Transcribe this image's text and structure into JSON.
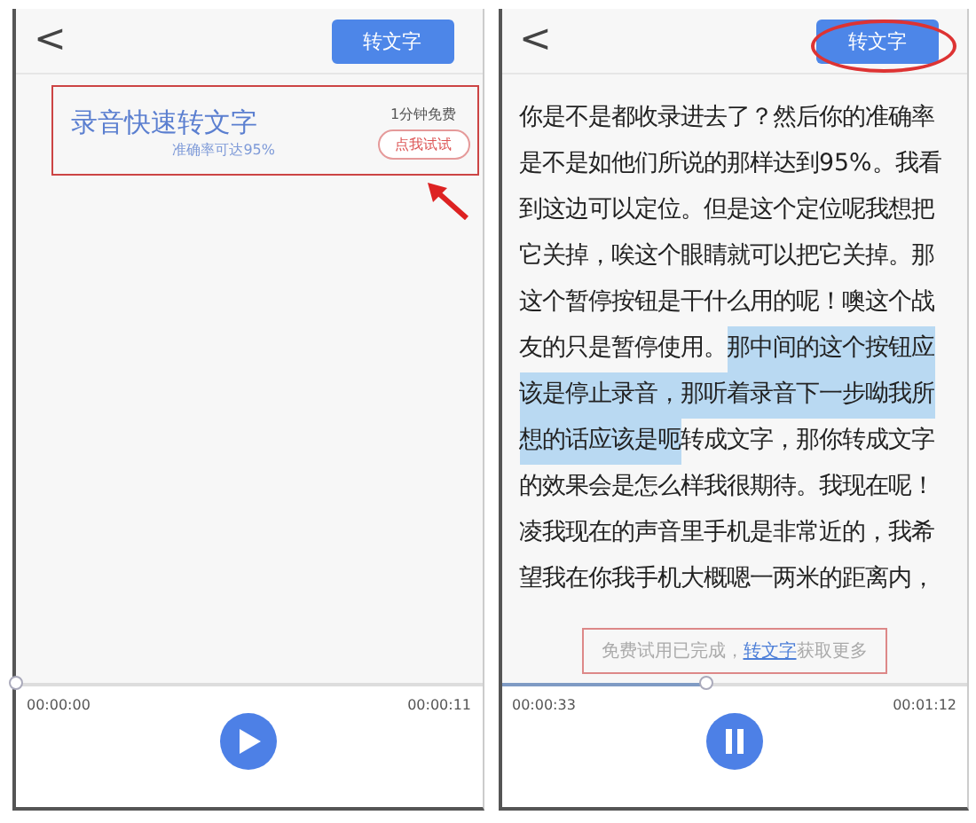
{
  "screens": [
    {
      "header": {
        "back": "<",
        "button": "转文字"
      },
      "card": {
        "title": "录音快速转文字",
        "subtitle": "准确率可达95%",
        "note": "1分钟免费",
        "action": "点我试试"
      },
      "player": {
        "elapsed": "00:00:00",
        "total": "00:00:11",
        "level": 0,
        "playing": false
      }
    },
    {
      "header": {
        "back": "<",
        "button": "转文字"
      },
      "transcript": [
        [
          {
            "text": "你是不是都收录进去了？然后你的准确率",
            "highlighted": false
          }
        ],
        [
          {
            "text": "是不是如他们所说的那样达到95%。我看",
            "highlighted": false
          }
        ],
        [
          {
            "text": "到这边可以定位。但是这个定位呢我想把",
            "highlighted": false
          }
        ],
        [
          {
            "text": "它关掉，唉这个眼睛就可以把它关掉。那",
            "highlighted": false
          }
        ],
        [
          {
            "text": "这个暂停按钮是干什么用的呢！噢这个战",
            "highlighted": false
          }
        ],
        [
          {
            "text": "友的只是暂停使用。",
            "highlighted": false
          },
          {
            "text": "那中间的这个按钮应",
            "highlighted": true
          }
        ],
        [
          {
            "text": "该是停止录音，那听着录音下一步呦我所",
            "highlighted": true
          }
        ],
        [
          {
            "text": "想的话应该是呃",
            "highlighted": true
          },
          {
            "text": "转成文字，那你转成文字",
            "highlighted": false
          }
        ],
        [
          {
            "text": "的效果会是怎么样我很期待。我现在呢！",
            "highlighted": false
          }
        ],
        [
          {
            "text": "凌我现在的声音里手机是非常近的，我希",
            "highlighted": false
          }
        ],
        [
          {
            "text": "望我在你我手机大概嗯一两米的距离内，",
            "highlighted": false
          }
        ]
      ],
      "notice": {
        "before": "免费试用已完成，",
        "link": "转文字",
        "after": "获取更多"
      },
      "player": {
        "elapsed": "00:00:33",
        "total": "00:01:12",
        "level": 0.44,
        "playing": true
      }
    }
  ]
}
